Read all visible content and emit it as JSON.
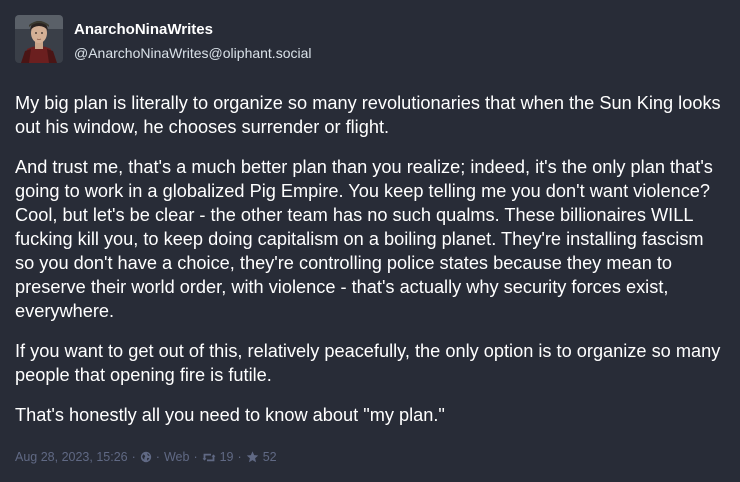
{
  "post": {
    "display_name": "AnarchoNinaWrites",
    "account": "@AnarchoNinaWrites@oliphant.social",
    "paragraphs": [
      "My big plan is literally to organize so many revolutionaries that when the Sun King looks out his window, he chooses surrender or flight.",
      "And trust me, that's a much better plan than you realize; indeed, it's the only plan that's going to work in a globalized Pig Empire. You keep telling me you don't want violence? Cool, but let's be clear - the other team has no such qualms. These billionaires WILL fucking kill you, to keep doing capitalism on a boiling planet. They're installing fascism so you don't have a choice, they're controlling police states because they mean to preserve their world order, with violence - that's actually why security forces exist, everywhere.",
      "If you want to get out of this, relatively peacefully, the only option is to organize so many people that opening fire is futile.",
      "That's honestly all you need to know about \"my plan.\""
    ]
  },
  "meta": {
    "timestamp": "Aug 28, 2023, 15:26",
    "separator": "·",
    "visibility_icon": "globe-icon",
    "application": "Web",
    "boost_icon": "retweet-icon",
    "boosts": "19",
    "favourite_icon": "star-icon",
    "favourites": "52"
  },
  "colors": {
    "background": "#282c37",
    "text": "#ffffff",
    "handle": "#d9e1e8",
    "meta": "#606984"
  }
}
